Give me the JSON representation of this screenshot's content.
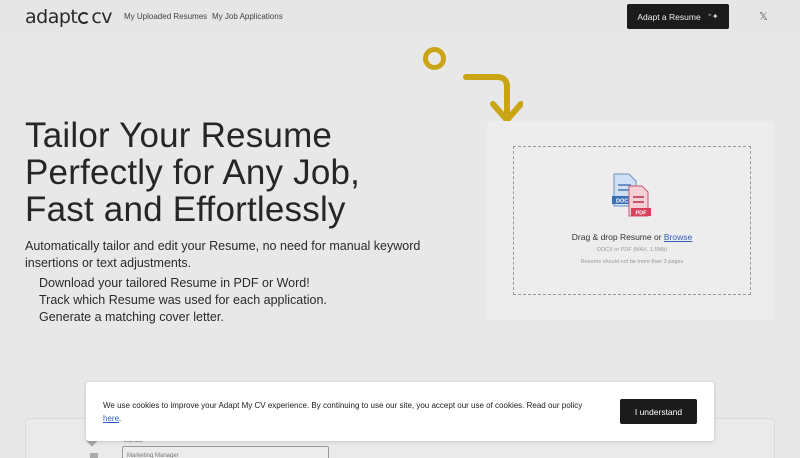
{
  "header": {
    "logo_text_1": "adapt",
    "logo_text_2": "cv",
    "nav": [
      "My Uploaded Resumes",
      "My Job Applications"
    ],
    "cta_label": "Adapt a Resume",
    "cta_icon": "sparkle-icon",
    "social_icon": "x-icon"
  },
  "hero": {
    "title_lines": [
      "Tailor Your Resume",
      "Perfectly for Any Job,",
      "Fast and Effortlessly"
    ],
    "subtitle": "Automatically tailor and edit your Resume, no need for manual keyword insertions or text adjustments.",
    "features": [
      "Download your tailored Resume in PDF or Word!",
      "Track which Resume was used for each application.",
      "Generate a matching cover letter."
    ]
  },
  "upload": {
    "title_prefix": "Drag & drop Resume or ",
    "browse_label": "Browse",
    "formats": "DOCX or PDF (MAX. 1.5Mb)",
    "limit": "Resume should not be more than 3 pages",
    "docx_tag": "DOCX",
    "pdf_tag": "PDF"
  },
  "bottom": {
    "field_label": "Job title",
    "field_value": "Marketing Manager"
  },
  "cookie": {
    "text": "We use cookies to improve your Adapt My CV experience. By continuing to use our site, you accept our use of cookies. Read our policy ",
    "link_label": "here",
    "suffix": ".",
    "button_label": "I understand"
  },
  "colors": {
    "accent_gold": "#c9a515",
    "dark_button": "#1b1b1b",
    "link_blue": "#2f5fb8"
  }
}
